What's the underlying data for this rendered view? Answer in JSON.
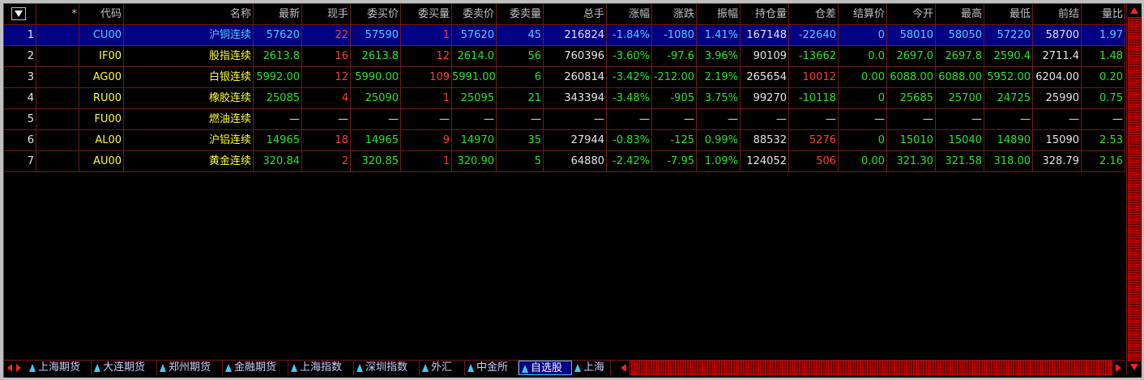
{
  "headers": [
    "",
    "*",
    "代码",
    "名称",
    "最新",
    "现手",
    "委买价",
    "委买量",
    "委卖价",
    "委卖量",
    "总手",
    "涨幅",
    "涨跌",
    "振幅",
    "持仓量",
    "仓差",
    "结算价",
    "今开",
    "最高",
    "最低",
    "前结",
    "量比"
  ],
  "rows": [
    {
      "idx": "1",
      "star": "",
      "code": "CU00",
      "name": "沪铜连续",
      "last": "57620",
      "cur": "22",
      "bid": "57590",
      "bidv": "1",
      "ask": "57620",
      "askv": "45",
      "vol": "216824",
      "pct": "-1.84%",
      "chg": "-1080",
      "amp": "1.41%",
      "oi": "167148",
      "oid": "-22640",
      "settle": "0",
      "open": "58010",
      "high": "58050",
      "low": "57220",
      "pre": "58700",
      "ratio": "1.97"
    },
    {
      "idx": "2",
      "star": "",
      "code": "IF00",
      "name": "股指连续",
      "last": "2613.8",
      "cur": "16",
      "bid": "2613.8",
      "bidv": "12",
      "ask": "2614.0",
      "askv": "56",
      "vol": "760396",
      "pct": "-3.60%",
      "chg": "-97.6",
      "amp": "3.96%",
      "oi": "90109",
      "oid": "-13662",
      "settle": "0.0",
      "open": "2697.0",
      "high": "2697.8",
      "low": "2590.4",
      "pre": "2711.4",
      "ratio": "1.48"
    },
    {
      "idx": "3",
      "star": "",
      "code": "AG00",
      "name": "白银连续",
      "last": "5992.00",
      "cur": "12",
      "bid": "5990.00",
      "bidv": "109",
      "ask": "5991.00",
      "askv": "6",
      "vol": "260814",
      "pct": "-3.42%",
      "chg": "-212.00",
      "amp": "2.19%",
      "oi": "265654",
      "oid": "10012",
      "settle": "0.00",
      "open": "6088.00",
      "high": "6088.00",
      "low": "5952.00",
      "pre": "6204.00",
      "ratio": "0.20"
    },
    {
      "idx": "4",
      "star": "",
      "code": "RU00",
      "name": "橡胶连续",
      "last": "25085",
      "cur": "4",
      "bid": "25090",
      "bidv": "1",
      "ask": "25095",
      "askv": "21",
      "vol": "343394",
      "pct": "-3.48%",
      "chg": "-905",
      "amp": "3.75%",
      "oi": "99270",
      "oid": "-10118",
      "settle": "0",
      "open": "25685",
      "high": "25700",
      "low": "24725",
      "pre": "25990",
      "ratio": "0.75"
    },
    {
      "idx": "5",
      "star": "",
      "code": "FU00",
      "name": "燃油连续",
      "last": "—",
      "cur": "—",
      "bid": "—",
      "bidv": "—",
      "ask": "—",
      "askv": "—",
      "vol": "—",
      "pct": "—",
      "chg": "—",
      "amp": "—",
      "oi": "—",
      "oid": "—",
      "settle": "—",
      "open": "—",
      "high": "—",
      "low": "—",
      "pre": "—",
      "ratio": "—"
    },
    {
      "idx": "6",
      "star": "",
      "code": "AL00",
      "name": "沪铝连续",
      "last": "14965",
      "cur": "18",
      "bid": "14965",
      "bidv": "9",
      "ask": "14970",
      "askv": "35",
      "vol": "27944",
      "pct": "-0.83%",
      "chg": "-125",
      "amp": "0.99%",
      "oi": "88532",
      "oid": "5276",
      "settle": "0",
      "open": "15010",
      "high": "15040",
      "low": "14890",
      "pre": "15090",
      "ratio": "2.53"
    },
    {
      "idx": "7",
      "star": "",
      "code": "AU00",
      "name": "黄金连续",
      "last": "320.84",
      "cur": "2",
      "bid": "320.85",
      "bidv": "1",
      "ask": "320.90",
      "askv": "5",
      "vol": "64880",
      "pct": "-2.42%",
      "chg": "-7.95",
      "amp": "1.09%",
      "oi": "124052",
      "oid": "506",
      "settle": "0.00",
      "open": "321.30",
      "high": "321.58",
      "low": "318.00",
      "pre": "328.79",
      "ratio": "2.16"
    }
  ],
  "tabs": [
    "上海期货",
    "大连期货",
    "郑州期货",
    "金融期货",
    "上海指数",
    "深圳指数",
    "外汇",
    "中金所",
    "自选股",
    "上海"
  ],
  "active_tab": "自选股",
  "colors": {
    "up": "#ff3c3c",
    "down": "#26e626",
    "neutral": "#e6e6e6",
    "code": "#ffff30",
    "selected_row": "#000084",
    "grid": "#6b1b1b"
  }
}
